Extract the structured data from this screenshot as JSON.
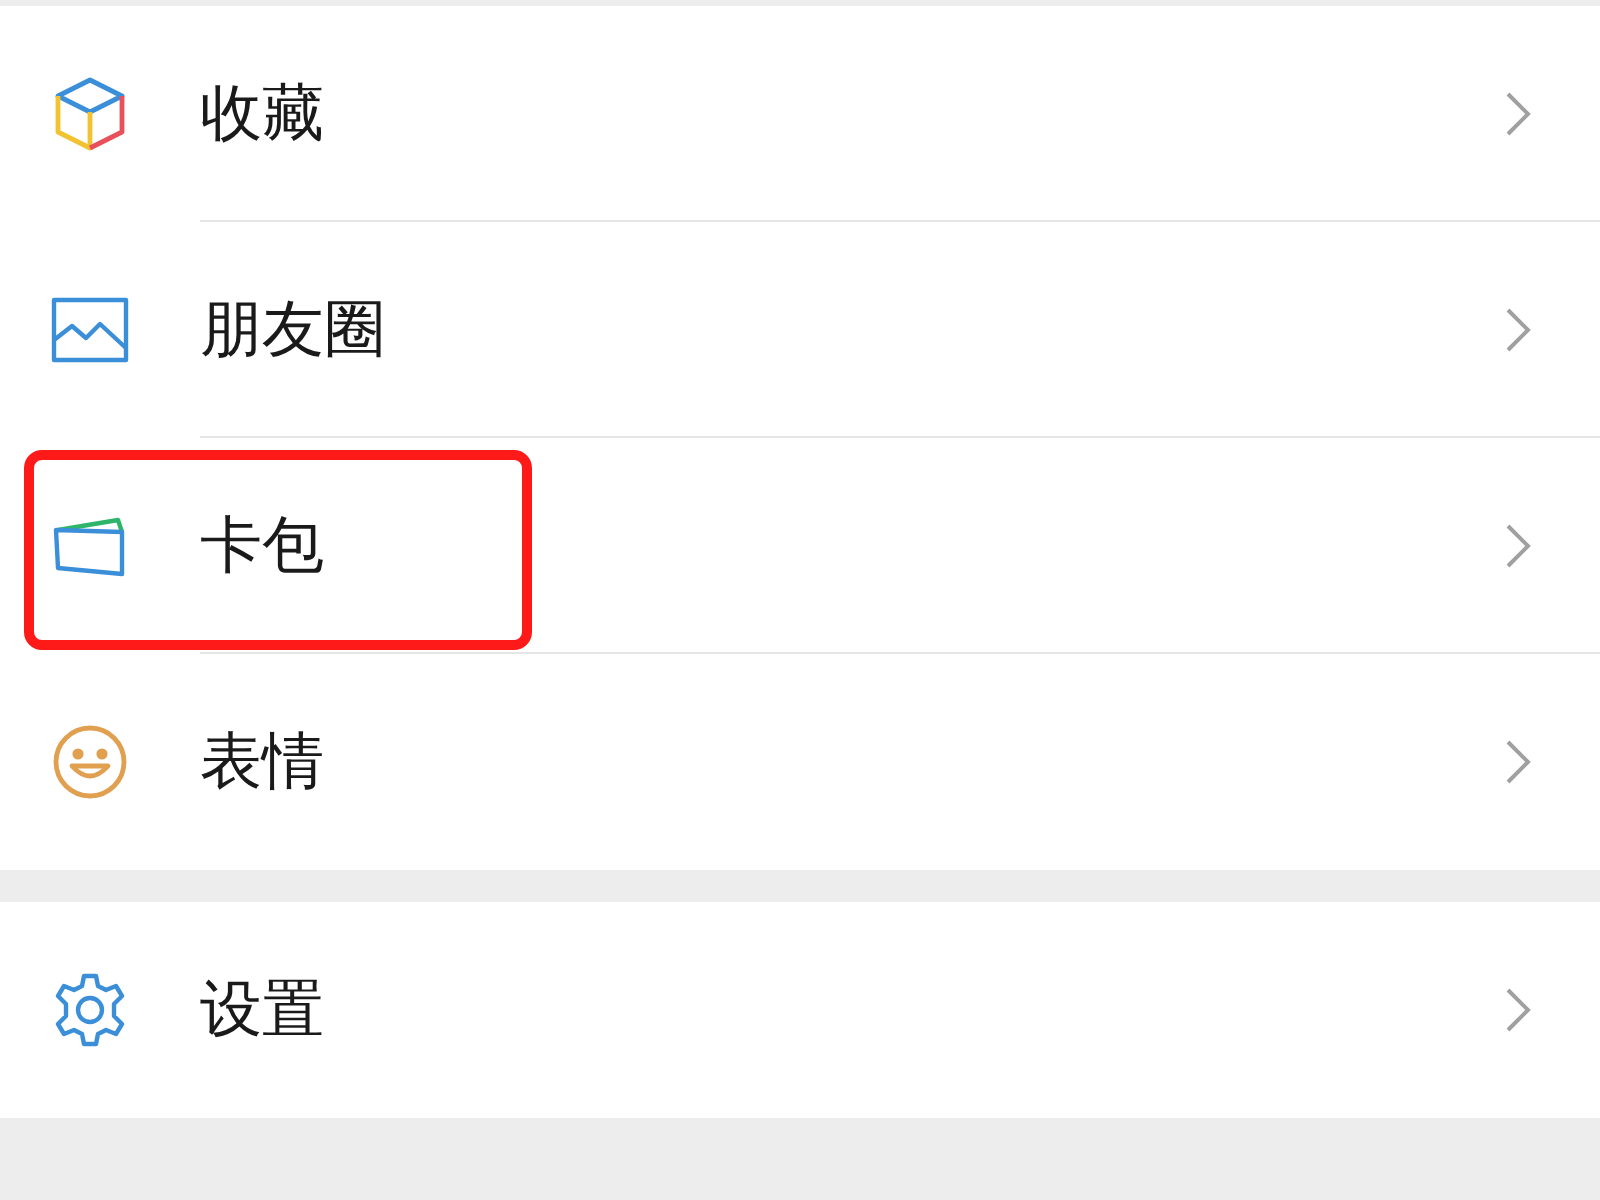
{
  "groups": [
    {
      "items": [
        {
          "kind": "cube",
          "label": "收藏",
          "highlighted": false
        },
        {
          "kind": "photo",
          "label": "朋友圈",
          "highlighted": false
        },
        {
          "kind": "wallet",
          "label": "卡包",
          "highlighted": true
        },
        {
          "kind": "smiley",
          "label": "表情",
          "highlighted": false
        }
      ]
    },
    {
      "items": [
        {
          "kind": "gear",
          "label": "设置",
          "highlighted": false
        }
      ]
    }
  ]
}
